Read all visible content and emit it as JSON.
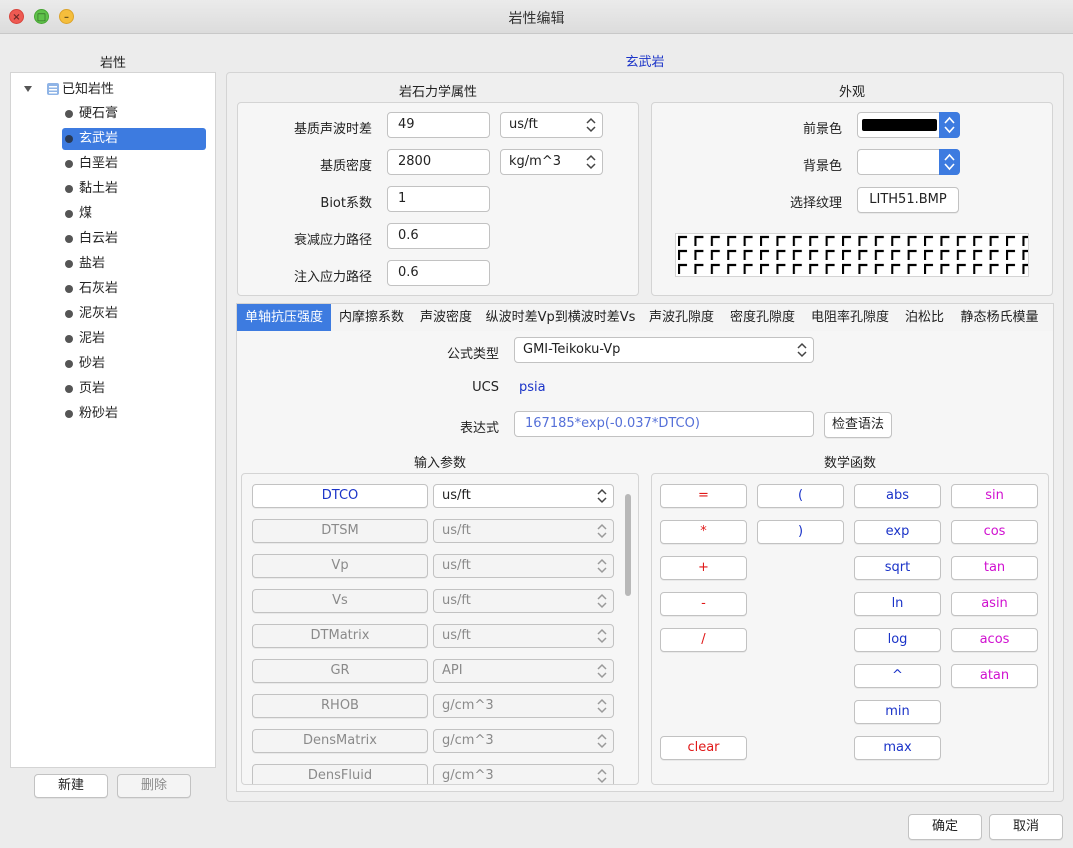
{
  "window": {
    "title": "岩性编辑"
  },
  "left": {
    "title": "岩性",
    "tree_root": "已知岩性",
    "items": [
      "硬石膏",
      "玄武岩",
      "白垩岩",
      "黏土岩",
      "煤",
      "白云岩",
      "盐岩",
      "石灰岩",
      "泥灰岩",
      "泥岩",
      "砂岩",
      "页岩",
      "粉砂岩"
    ],
    "selected_index": 1,
    "new_button": "新建",
    "delete_button": "删除"
  },
  "main": {
    "lithology_name": "玄武岩",
    "rock_props": {
      "title": "岩石力学属性",
      "fields": [
        {
          "label": "基质声波时差",
          "value": "49",
          "unit": "us/ft"
        },
        {
          "label": "基质密度",
          "value": "2800",
          "unit": "kg/m^3"
        },
        {
          "label": "Biot系数",
          "value": "1"
        },
        {
          "label": "衰减应力路径",
          "value": "0.6"
        },
        {
          "label": "注入应力路径",
          "value": "0.6"
        }
      ]
    },
    "appearance": {
      "title": "外观",
      "foreground_label": "前景色",
      "foreground_color": "#000000",
      "background_label": "背景色",
      "background_color": "#ffffff",
      "texture_label": "选择纹理",
      "texture_button": "LITH51.BMP"
    },
    "tabs": [
      "单轴抗压强度",
      "内摩擦系数",
      "声波密度",
      "纵波时差Vp到横波时差Vs",
      "声波孔隙度",
      "密度孔隙度",
      "电阻率孔隙度",
      "泊松比",
      "静态杨氏模量"
    ],
    "active_tab": 0,
    "formula": {
      "type_label": "公式类型",
      "type_value": "GMI-Teikoku-Vp",
      "ucs_label": "UCS",
      "ucs_value": "psia",
      "expr_label": "表达式",
      "expr_value": "167185*exp(-0.037*DTCO)",
      "check_button": "检查语法"
    },
    "input_params": {
      "title": "输入参数",
      "rows": [
        {
          "name": "DTCO",
          "unit": "us/ft",
          "enabled": true
        },
        {
          "name": "DTSM",
          "unit": "us/ft",
          "enabled": false
        },
        {
          "name": "Vp",
          "unit": "us/ft",
          "enabled": false
        },
        {
          "name": "Vs",
          "unit": "us/ft",
          "enabled": false
        },
        {
          "name": "DTMatrix",
          "unit": "us/ft",
          "enabled": false
        },
        {
          "name": "GR",
          "unit": "API",
          "enabled": false
        },
        {
          "name": "RHOB",
          "unit": "g/cm^3",
          "enabled": false
        },
        {
          "name": "DensMatrix",
          "unit": "g/cm^3",
          "enabled": false
        },
        {
          "name": "DensFluid",
          "unit": "g/cm^3",
          "enabled": false
        }
      ]
    },
    "math": {
      "title": "数学函数",
      "col1": [
        "=",
        "*",
        "+",
        "-",
        "/",
        "clear"
      ],
      "col2": [
        "(",
        ")"
      ],
      "col3": [
        "abs",
        "exp",
        "sqrt",
        "ln",
        "log",
        "^",
        "min",
        "max"
      ],
      "col4": [
        "sin",
        "cos",
        "tan",
        "asin",
        "acos",
        "atan"
      ]
    },
    "ok_button": "确定",
    "cancel_button": "取消"
  },
  "colors": {
    "accent": "#3d7be0",
    "operator": "#e01818",
    "function": "#1a33c8",
    "trig": "#d010d0"
  }
}
